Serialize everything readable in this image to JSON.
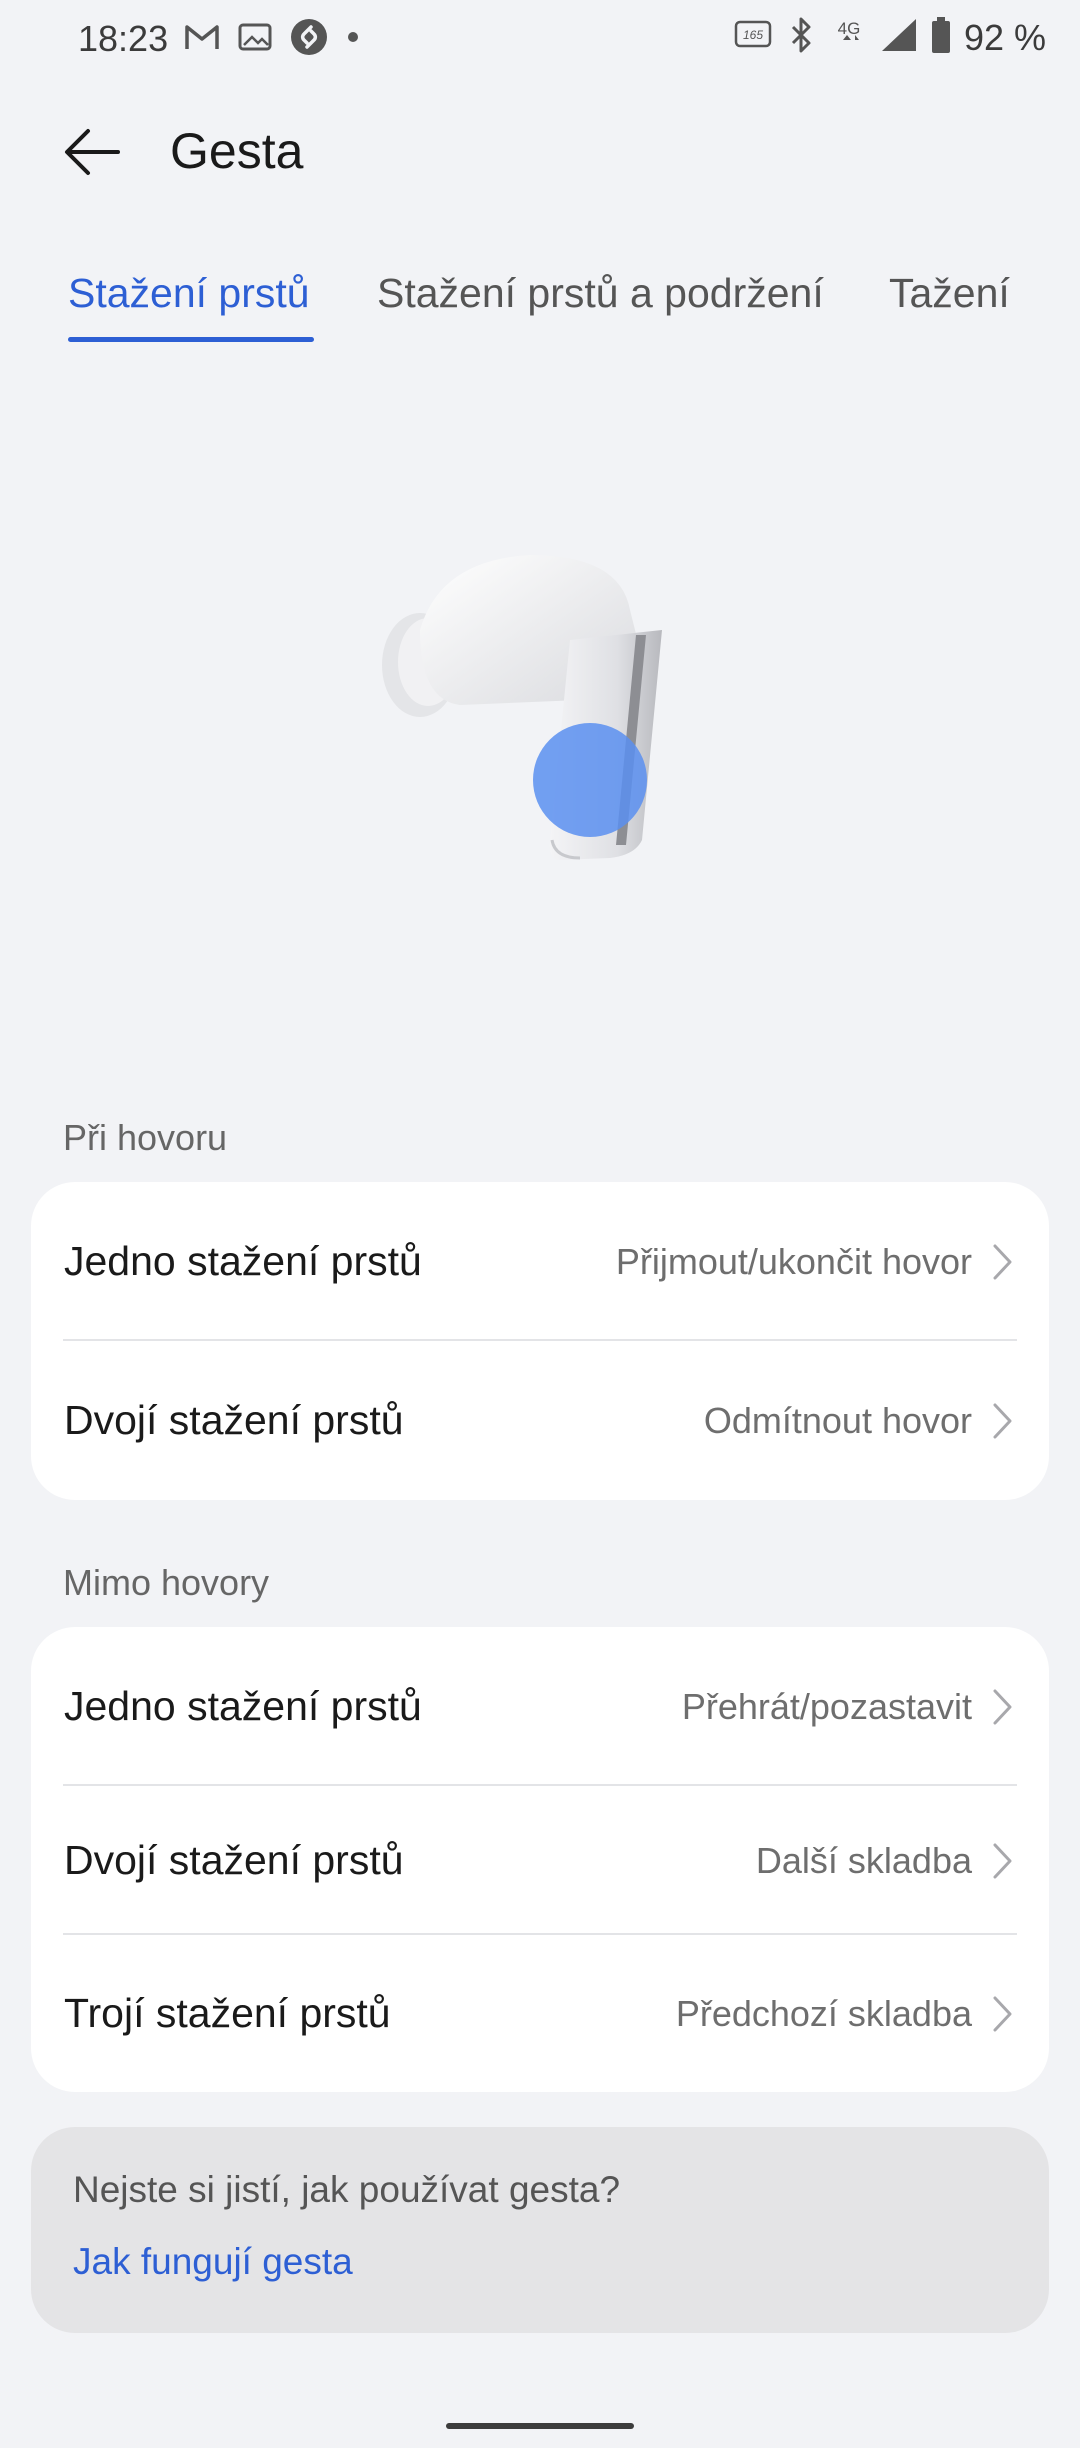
{
  "status_bar": {
    "time": "18:23",
    "battery_text": "92 %",
    "network_label": "4G",
    "refresh_rate_label": "165",
    "left_icons": [
      "gmail-icon",
      "gallery-icon",
      "shazam-icon",
      "notification-dot-icon"
    ],
    "right_icons": [
      "refresh-rate-icon",
      "bluetooth-icon",
      "network-4g-icon",
      "signal-icon",
      "battery-icon"
    ]
  },
  "header": {
    "title": "Gesta",
    "back_icon": "back-arrow-icon"
  },
  "tabs": [
    {
      "label": "Stažení prstů",
      "active": true
    },
    {
      "label": "Stažení prstů a podržení",
      "active": false
    },
    {
      "label": "Tažení",
      "active": false
    }
  ],
  "illustration": {
    "icon": "earbud-illustration",
    "accent": "#5b8ff0"
  },
  "sections": [
    {
      "title": "Při hovoru",
      "items": [
        {
          "label": "Jedno stažení prstů",
          "value": "Přijmout/ukončit hovor"
        },
        {
          "label": "Dvojí stažení prstů",
          "value": "Odmítnout hovor"
        }
      ]
    },
    {
      "title": "Mimo hovory",
      "items": [
        {
          "label": "Jedno stažení prstů",
          "value": "Přehrát/pozastavit"
        },
        {
          "label": "Dvojí stažení prstů",
          "value": "Další skladba"
        },
        {
          "label": "Trojí stažení prstů",
          "value": "Předchozí skladba"
        }
      ]
    }
  ],
  "help": {
    "question": "Nejste si jistí, jak používat gesta?",
    "link": "Jak fungují gesta"
  },
  "colors": {
    "accent": "#2d5fd4",
    "background": "#f2f3f6",
    "card": "#ffffff"
  }
}
